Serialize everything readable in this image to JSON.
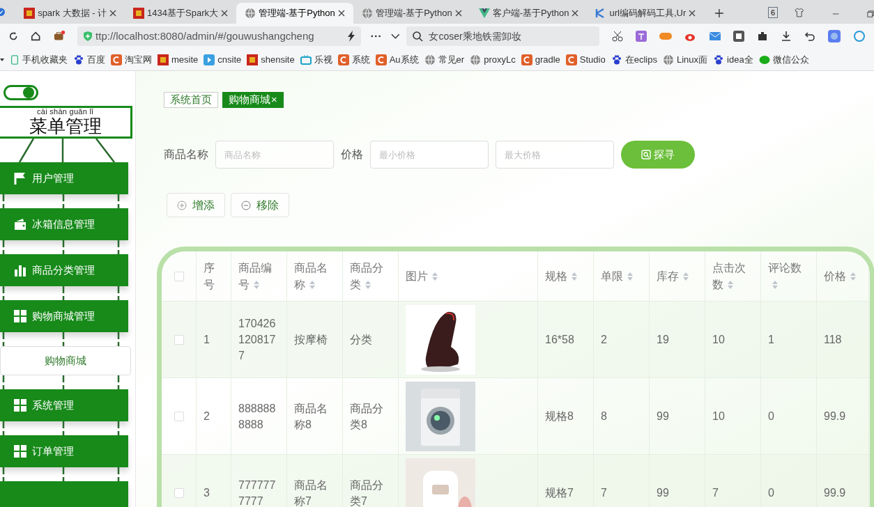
{
  "browser": {
    "tabs": [
      {
        "title": "spark 大数据 - 计",
        "selected": false
      },
      {
        "title": "1434基于Spark大",
        "selected": false
      },
      {
        "title": "管理端-基于Python",
        "selected": true
      },
      {
        "title": "管理端-基于Python",
        "selected": false
      },
      {
        "title": "客户端-基于Python",
        "selected": false
      },
      {
        "title": "url编码解码工具,Ur",
        "selected": false
      }
    ],
    "tab_count": "6",
    "address": "ttp://localhost:8080/admin/#/gouwushangcheng",
    "search": "女coser乘地铁需卸妆",
    "bookmarks": [
      "手机收藏夹",
      "百度",
      "淘宝网",
      "mesite",
      "cnsite",
      "shensite",
      "乐视",
      "系统",
      "Au系统",
      "常见er",
      "proxyLc",
      "gradle",
      "Studio",
      "在eclips",
      "Linux面",
      "idea全",
      "微信公众"
    ]
  },
  "sidebar": {
    "toggle": {
      "on": true
    },
    "title": {
      "text": "菜单管理",
      "pinyin": "cài shàn guǎn lǐ"
    },
    "items": [
      {
        "kind": "menu",
        "label": "用户管理"
      },
      {
        "kind": "menu",
        "label": "冰箱信息管理"
      },
      {
        "kind": "menu",
        "label": "商品分类管理"
      },
      {
        "kind": "menu",
        "label": "购物商城管理",
        "children": [
          {
            "label": "购物商城",
            "selected": true
          }
        ]
      },
      {
        "kind": "menu",
        "label": "系统管理"
      },
      {
        "kind": "menu",
        "label": "订单管理"
      },
      {
        "kind": "menu"
      }
    ]
  },
  "tags": [
    {
      "label": "系统首页",
      "selected": false
    },
    {
      "label": "购物商城",
      "selected": true,
      "close": "×"
    }
  ],
  "search_form": {
    "name_label": "商品名称",
    "name_placeholder": "商品名称",
    "price_label": "价格",
    "min_placeholder": "最小价格",
    "max_placeholder": "最大价格",
    "button": "探寻"
  },
  "actions": [
    {
      "label": "增添",
      "kind": "add"
    },
    {
      "label": "移除",
      "kind": "remove"
    }
  ],
  "table": {
    "all_checked": false,
    "columns": [
      "序号",
      "商品编号",
      "商品名称",
      "商品分类",
      "图片",
      "规格",
      "单限",
      "库存",
      "点击次数",
      "评论数",
      "价格"
    ],
    "rows": [
      {
        "cells": [
          "1",
          "1704261208177",
          "按摩椅",
          "分类",
          "",
          "16*58",
          "2",
          "19",
          "10",
          "1",
          "118"
        ],
        "checked": false
      },
      {
        "cells": [
          "2",
          "8888888888",
          "商品名称8",
          "商品分类8",
          "",
          "规格8",
          "8",
          "99",
          "10",
          "0",
          "99.9"
        ],
        "checked": false
      },
      {
        "cells": [
          "3",
          "7777777777",
          "商品名称7",
          "商品分类7",
          "",
          "规格7",
          "7",
          "99",
          "7",
          "0",
          "99.9"
        ],
        "checked": false
      }
    ]
  }
}
